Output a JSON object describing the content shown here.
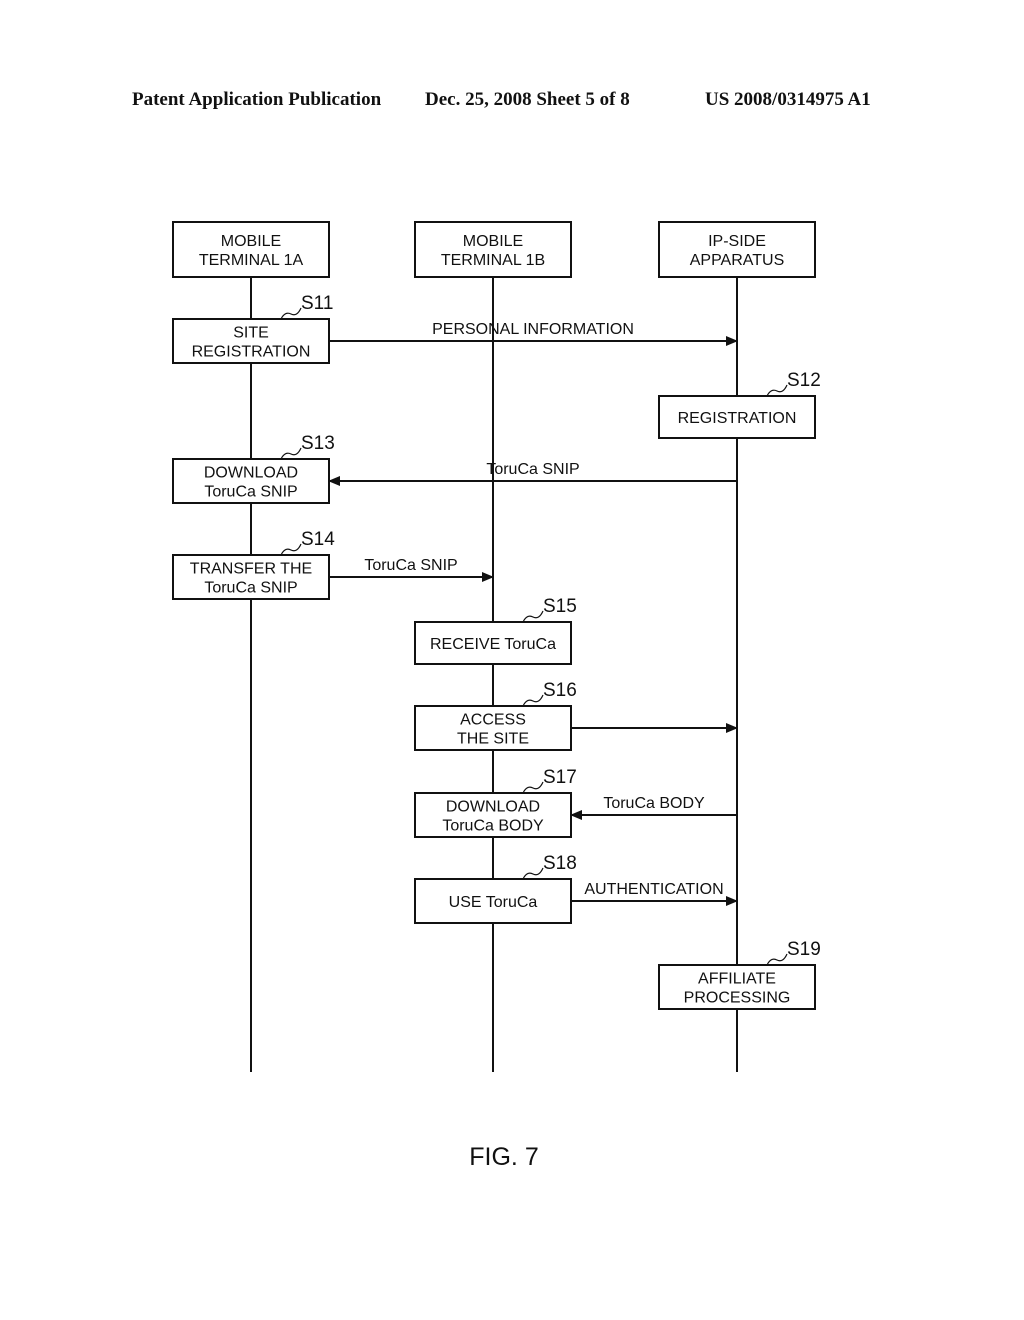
{
  "header": {
    "publication": "Patent Application Publication",
    "date_sheet": "Dec. 25, 2008   Sheet 5 of 8",
    "number": "US 2008/0314975 A1"
  },
  "actors": [
    {
      "id": "a",
      "lines": [
        "MOBILE",
        "TERMINAL 1A"
      ]
    },
    {
      "id": "b",
      "lines": [
        "MOBILE",
        "TERMINAL 1B"
      ]
    },
    {
      "id": "c",
      "lines": [
        "IP-SIDE",
        "APPARATUS"
      ]
    }
  ],
  "steps": [
    {
      "id": "S11",
      "actor": 0,
      "row": 0,
      "lines": [
        "SITE",
        "REGISTRATION"
      ]
    },
    {
      "id": "S12",
      "actor": 2,
      "row": 1,
      "lines": [
        "REGISTRATION"
      ]
    },
    {
      "id": "S13",
      "actor": 0,
      "row": 2,
      "lines": [
        "DOWNLOAD",
        "ToruCa SNIP"
      ]
    },
    {
      "id": "S14",
      "actor": 0,
      "row": 3,
      "lines": [
        "TRANSFER THE",
        "ToruCa SNIP"
      ]
    },
    {
      "id": "S15",
      "actor": 1,
      "row": 4,
      "lines": [
        "RECEIVE ToruCa"
      ]
    },
    {
      "id": "S16",
      "actor": 1,
      "row": 5,
      "lines": [
        "ACCESS",
        "THE SITE"
      ]
    },
    {
      "id": "S17",
      "actor": 1,
      "row": 6,
      "lines": [
        "DOWNLOAD",
        "ToruCa BODY"
      ]
    },
    {
      "id": "S18",
      "actor": 1,
      "row": 7,
      "lines": [
        "USE ToruCa"
      ]
    },
    {
      "id": "S19",
      "actor": 2,
      "row": 8,
      "lines": [
        "AFFILIATE",
        "PROCESSING"
      ]
    }
  ],
  "messages": [
    {
      "from": 0,
      "to": 2,
      "row": 0,
      "label": "PERSONAL INFORMATION"
    },
    {
      "from": 2,
      "to": 0,
      "row": 2,
      "label": "ToruCa SNIP"
    },
    {
      "from": 0,
      "to": 1,
      "row": 3,
      "label": "ToruCa SNIP"
    },
    {
      "from": 1,
      "to": 2,
      "row": 5,
      "label": ""
    },
    {
      "from": 2,
      "to": 1,
      "row": 6,
      "label": "ToruCa BODY"
    },
    {
      "from": 1,
      "to": 2,
      "row": 7,
      "label": "AUTHENTICATION"
    }
  ],
  "figure_caption": "FIG. 7"
}
